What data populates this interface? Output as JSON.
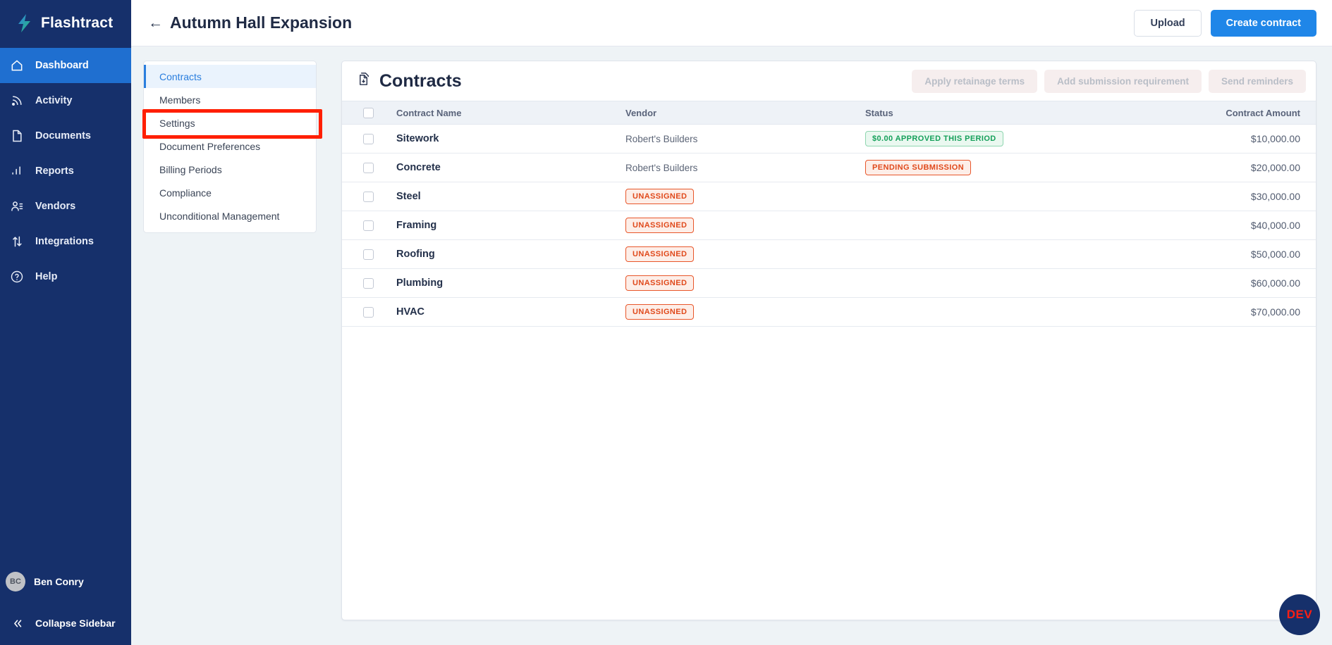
{
  "brand": {
    "name": "Flashtract",
    "logo_icon": "lightning-bolt-icon"
  },
  "sidebar": {
    "items": [
      {
        "label": "Dashboard",
        "icon": "home-icon",
        "active": true
      },
      {
        "label": "Activity",
        "icon": "activity-rss-icon",
        "active": false
      },
      {
        "label": "Documents",
        "icon": "document-icon",
        "active": false
      },
      {
        "label": "Reports",
        "icon": "bar-chart-icon",
        "active": false
      },
      {
        "label": "Vendors",
        "icon": "people-icon",
        "active": false
      },
      {
        "label": "Integrations",
        "icon": "arrows-updown-icon",
        "active": false
      },
      {
        "label": "Help",
        "icon": "question-circle-icon",
        "active": false
      }
    ],
    "user": {
      "initials": "BC",
      "name": "Ben Conry"
    },
    "collapse_label": "Collapse Sidebar",
    "collapse_icon": "double-chevron-left-icon"
  },
  "topbar": {
    "back_icon": "arrow-left-icon",
    "title": "Autumn Hall Expansion",
    "upload_label": "Upload",
    "create_label": "Create contract"
  },
  "subnav": {
    "items": [
      {
        "label": "Contracts",
        "active": true,
        "highlighted": false
      },
      {
        "label": "Members",
        "active": false,
        "highlighted": false
      },
      {
        "label": "Settings",
        "active": false,
        "highlighted": true
      },
      {
        "label": "Document Preferences",
        "active": false,
        "highlighted": false
      },
      {
        "label": "Billing Periods",
        "active": false,
        "highlighted": false
      },
      {
        "label": "Compliance",
        "active": false,
        "highlighted": false
      },
      {
        "label": "Unconditional Management",
        "active": false,
        "highlighted": false
      }
    ]
  },
  "contracts_card": {
    "icon": "stacked-documents-download-icon",
    "title": "Contracts",
    "actions": [
      {
        "label": "Apply retainage terms",
        "disabled": true
      },
      {
        "label": "Add submission requirement",
        "disabled": true
      },
      {
        "label": "Send reminders",
        "disabled": true
      }
    ],
    "columns": [
      "",
      "Contract Name",
      "Vendor",
      "Status",
      "Contract Amount"
    ],
    "rows": [
      {
        "name": "Sitework",
        "vendor": "Robert's Builders",
        "vendor_badge": null,
        "status": "$0.00 APPROVED THIS PERIOD",
        "status_type": "green",
        "amount": "$10,000.00"
      },
      {
        "name": "Concrete",
        "vendor": "Robert's Builders",
        "vendor_badge": null,
        "status": "PENDING SUBMISSION",
        "status_type": "orange",
        "amount": "$20,000.00"
      },
      {
        "name": "Steel",
        "vendor": null,
        "vendor_badge": "UNASSIGNED",
        "status": null,
        "status_type": null,
        "amount": "$30,000.00"
      },
      {
        "name": "Framing",
        "vendor": null,
        "vendor_badge": "UNASSIGNED",
        "status": null,
        "status_type": null,
        "amount": "$40,000.00"
      },
      {
        "name": "Roofing",
        "vendor": null,
        "vendor_badge": "UNASSIGNED",
        "status": null,
        "status_type": null,
        "amount": "$50,000.00"
      },
      {
        "name": "Plumbing",
        "vendor": null,
        "vendor_badge": "UNASSIGNED",
        "status": null,
        "status_type": null,
        "amount": "$60,000.00"
      },
      {
        "name": "HVAC",
        "vendor": null,
        "vendor_badge": "UNASSIGNED",
        "status": null,
        "status_type": null,
        "amount": "$70,000.00"
      }
    ]
  },
  "dev_badge": {
    "label": "DEV"
  },
  "colors": {
    "sidebar_bg": "#16306b",
    "sidebar_active": "#1f6fd0",
    "primary": "#1f86e8",
    "page_bg": "#eef3f6",
    "badge_green": "#15a05a",
    "badge_orange": "#e0491b",
    "annotation": "#ff1f00",
    "dev_text": "#ff1f13"
  }
}
